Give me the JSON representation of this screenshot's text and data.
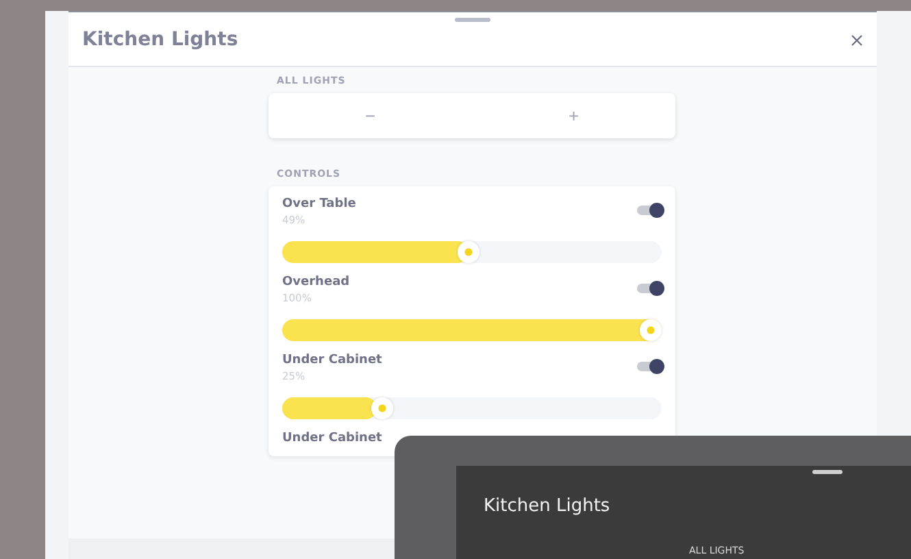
{
  "window": {
    "title": "Kitchen Lights"
  },
  "all_lights": {
    "label": "ALL LIGHTS",
    "decrease": "−",
    "increase": "+"
  },
  "controls": {
    "label": "CONTROLS",
    "items": [
      {
        "name": "Over Table",
        "reading": "49%",
        "on": true,
        "level": 0.49
      },
      {
        "name": "Overhead",
        "reading": "100%",
        "on": true,
        "level": 1
      },
      {
        "name": "Under Cabinet",
        "reading": "25%",
        "on": true,
        "level": 0.25
      },
      {
        "name": "Under Cabinet"
      }
    ]
  },
  "device": {
    "title": "Kitchen Lights",
    "section": "ALL LIGHTS"
  }
}
